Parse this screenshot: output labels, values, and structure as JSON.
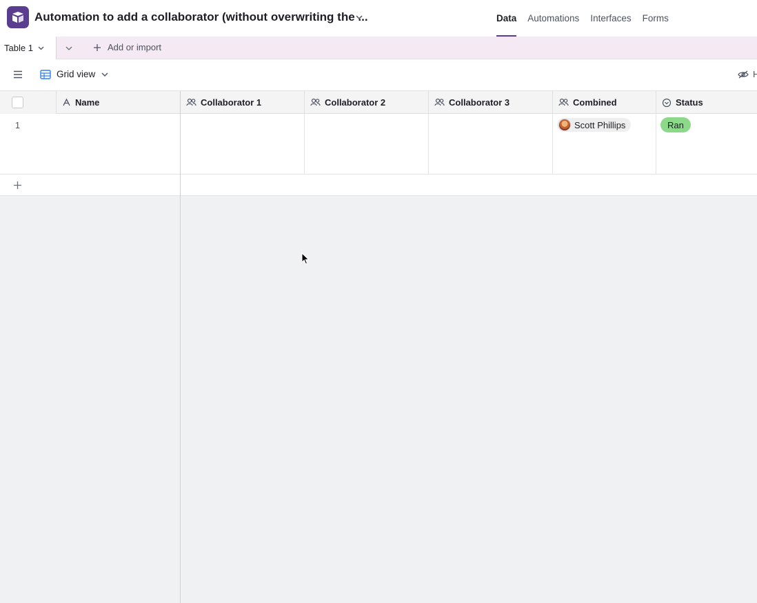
{
  "header": {
    "base_title": "Automation to add a collaborator (without overwriting the ...",
    "nav": [
      {
        "label": "Data",
        "active": true
      },
      {
        "label": "Automations",
        "active": false
      },
      {
        "label": "Interfaces",
        "active": false
      },
      {
        "label": "Forms",
        "active": false
      }
    ]
  },
  "tables": {
    "current": "Table 1",
    "add_label": "Add or import"
  },
  "view": {
    "name": "Grid view",
    "hide_fields_label": "H"
  },
  "grid": {
    "columns": [
      {
        "label": "Name",
        "icon": "text-field-icon"
      },
      {
        "label": "Collaborator 1",
        "icon": "users-icon"
      },
      {
        "label": "Collaborator 2",
        "icon": "users-icon"
      },
      {
        "label": "Collaborator 3",
        "icon": "users-icon"
      },
      {
        "label": "Combined",
        "icon": "users-icon"
      },
      {
        "label": "Status",
        "icon": "single-select-icon"
      }
    ],
    "rows": [
      {
        "number": "1",
        "combined": "Scott Phillips",
        "status": "Ran"
      }
    ]
  },
  "colors": {
    "brand": "#5b3d8f",
    "tabbar_bg": "#f5eaf3",
    "status_ran": "#8cd98a"
  }
}
